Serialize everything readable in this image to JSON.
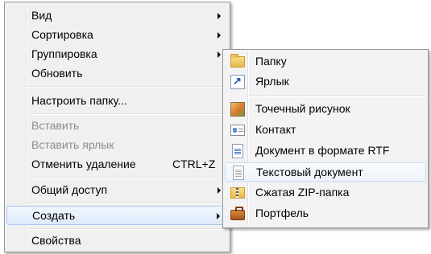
{
  "context_menu": {
    "items": [
      {
        "label": "Вид"
      },
      {
        "label": "Сортировка"
      },
      {
        "label": "Группировка"
      },
      {
        "label": "Обновить"
      },
      {
        "label": "Настроить папку..."
      },
      {
        "label": "Вставить"
      },
      {
        "label": "Вставить ярлык"
      },
      {
        "label": "Отменить удаление",
        "shortcut": "CTRL+Z"
      },
      {
        "label": "Общий доступ"
      },
      {
        "label": "Создать"
      },
      {
        "label": "Свойства"
      }
    ]
  },
  "create_submenu": {
    "items": [
      {
        "label": "Папку",
        "icon": "folder-icon"
      },
      {
        "label": "Ярлык",
        "icon": "shortcut-icon"
      },
      {
        "label": "Точечный рисунок",
        "icon": "bitmap-icon"
      },
      {
        "label": "Контакт",
        "icon": "contact-icon"
      },
      {
        "label": "Документ в формате RTF",
        "icon": "rtf-document-icon"
      },
      {
        "label": "Текстовый документ",
        "icon": "text-document-icon"
      },
      {
        "label": "Сжатая ZIP-папка",
        "icon": "zip-folder-icon"
      },
      {
        "label": "Портфель",
        "icon": "briefcase-icon"
      }
    ]
  },
  "colors": {
    "menu_background": "#f0f0f0",
    "menu_border": "#979797",
    "highlight_border": "#a8c8ee",
    "disabled_text": "#8d8d8d"
  }
}
